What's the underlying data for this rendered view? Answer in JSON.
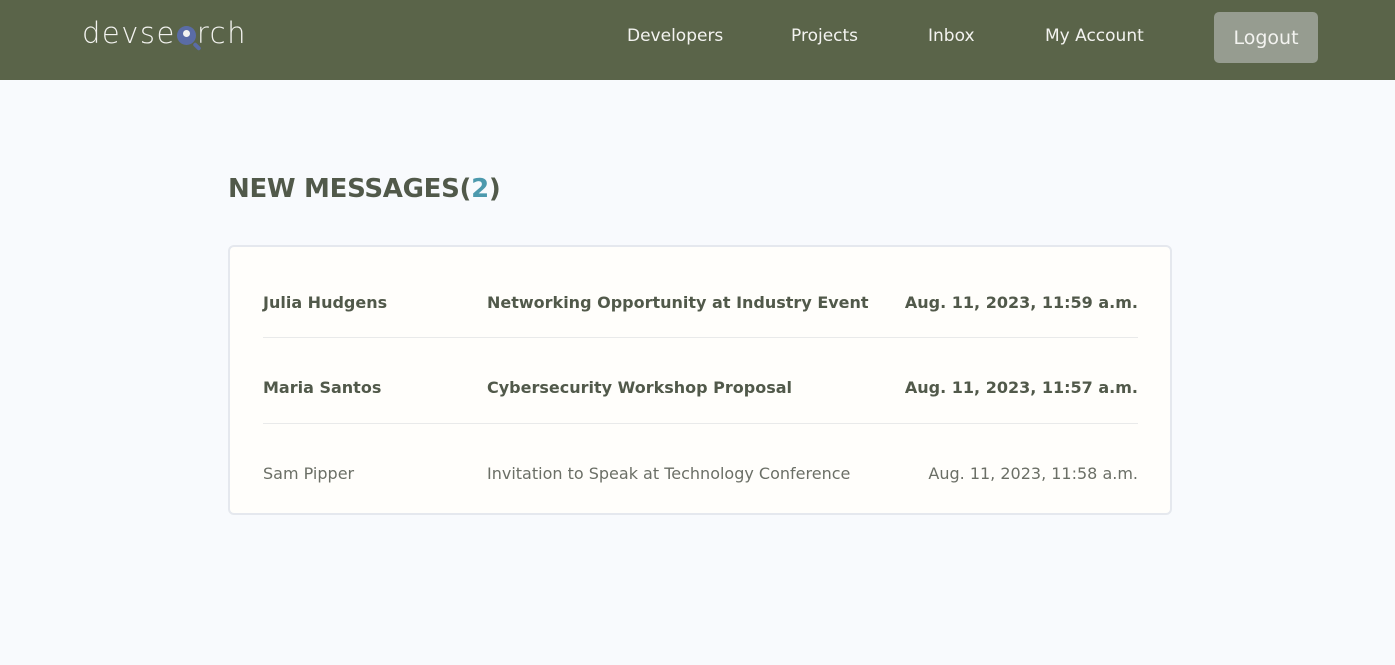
{
  "header": {
    "logo_prefix": "devse",
    "logo_suffix": "rch",
    "nav": [
      {
        "label": "Developers"
      },
      {
        "label": "Projects"
      },
      {
        "label": "Inbox"
      },
      {
        "label": "My Account"
      }
    ],
    "logout_label": "Logout"
  },
  "inbox": {
    "title": "NEW MESSAGES",
    "title_open": "(",
    "unread_count": "2",
    "title_close": ")",
    "messages": [
      {
        "sender": "Julia Hudgens",
        "subject": "Networking Opportunity at Industry Event",
        "date": "Aug. 11, 2023, 11:59 a.m.",
        "unread": true
      },
      {
        "sender": "Maria Santos",
        "subject": "Cybersecurity Workshop Proposal",
        "date": "Aug. 11, 2023, 11:57 a.m.",
        "unread": true
      },
      {
        "sender": "Sam Pipper",
        "subject": "Invitation to Speak at Technology Conference",
        "date": "Aug. 11, 2023, 11:58 a.m.",
        "unread": false
      }
    ]
  },
  "colors": {
    "header_bg": "#5a6449",
    "accent": "#4c99ad",
    "logo_icon": "#5a6ca6"
  },
  "icons": {
    "logo_search": "magnifier-person-icon"
  }
}
